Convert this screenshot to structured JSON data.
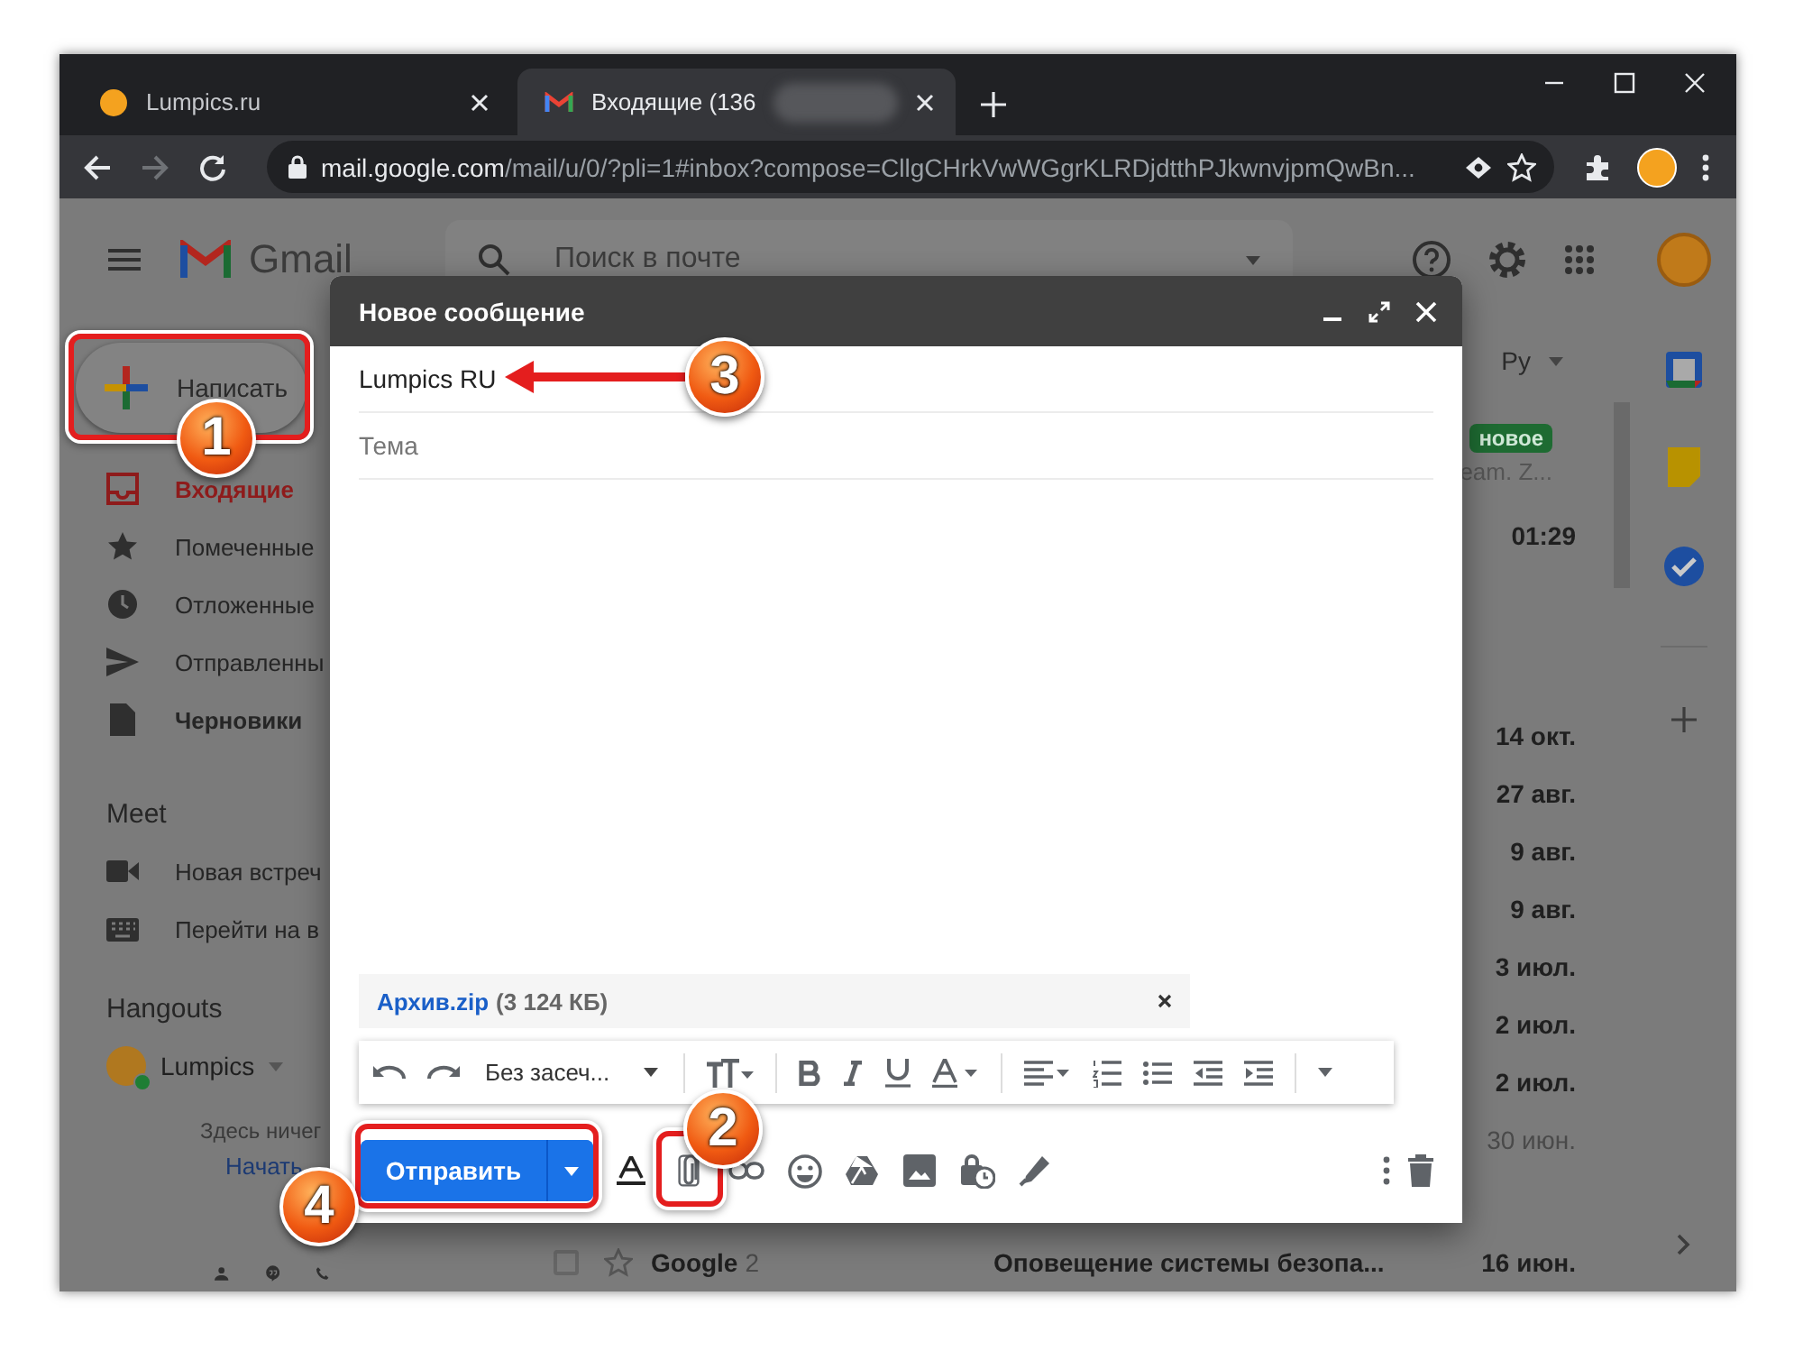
{
  "browser": {
    "tabs": [
      {
        "title": "Lumpics.ru",
        "kind": "site",
        "selected": false
      },
      {
        "title": "Входящие (136",
        "kind": "gmail",
        "selected": true
      }
    ],
    "address": {
      "host": "mail.google.com",
      "path": "/mail/u/0/?pli=1#inbox?compose=CllgCHrkVwWGgrKLRDjdtthPJkwnvjpmQwBn..."
    },
    "forward_disabled": true
  },
  "gmail": {
    "product_name": "Gmail",
    "search": {
      "placeholder": "Поиск в почте"
    },
    "compose_button": "Написать",
    "folders": [
      {
        "label": "Входящие",
        "kind": "inbox",
        "selected": true,
        "bold": true
      },
      {
        "label": "Помеченные",
        "kind": "star",
        "selected": false,
        "bold": false
      },
      {
        "label": "Отложенные",
        "kind": "clock",
        "selected": false,
        "bold": false
      },
      {
        "label": "Отправленны",
        "kind": "send",
        "selected": false,
        "bold": false
      },
      {
        "label": "Черновики",
        "kind": "file",
        "selected": false,
        "bold": true
      }
    ],
    "meet": {
      "title": "Meet",
      "items": [
        {
          "label": "Новая встреч",
          "kind": "video"
        },
        {
          "label": "Перейти на в",
          "kind": "keyboard"
        }
      ]
    },
    "hangouts": {
      "title": "Hangouts",
      "user": "Lumpics",
      "empty_text": "Здесь ничег",
      "start_link": "Начать"
    },
    "list": {
      "sort_label": "Ру",
      "badge": "новое",
      "snippet": "eam. Z...",
      "first_time": "01:29",
      "dates": [
        {
          "text": "14 окт.",
          "unread": true
        },
        {
          "text": "27 авг.",
          "unread": true
        },
        {
          "text": "9 авг.",
          "unread": true
        },
        {
          "text": "9 авг.",
          "unread": true
        },
        {
          "text": "3 июл.",
          "unread": true
        },
        {
          "text": "2 июл.",
          "unread": true
        },
        {
          "text": "2 июл.",
          "unread": true
        },
        {
          "text": "30 июн.",
          "unread": false
        }
      ],
      "last_row": {
        "checked": false,
        "sender": "Google",
        "count": "2",
        "subject": "Оповещение системы безопа...",
        "date": "16 июн."
      }
    }
  },
  "compose": {
    "title": "Новое сообщение",
    "to": "Lumpics RU",
    "subject": {
      "placeholder": "Тема"
    },
    "attachment": {
      "name": "Архив.zip",
      "size": "(3 124 КБ)"
    },
    "font": "Без засеч...",
    "send": "Отправить"
  },
  "callouts": [
    {
      "number": "1"
    },
    {
      "number": "2"
    },
    {
      "number": "3"
    },
    {
      "number": "4"
    }
  ]
}
